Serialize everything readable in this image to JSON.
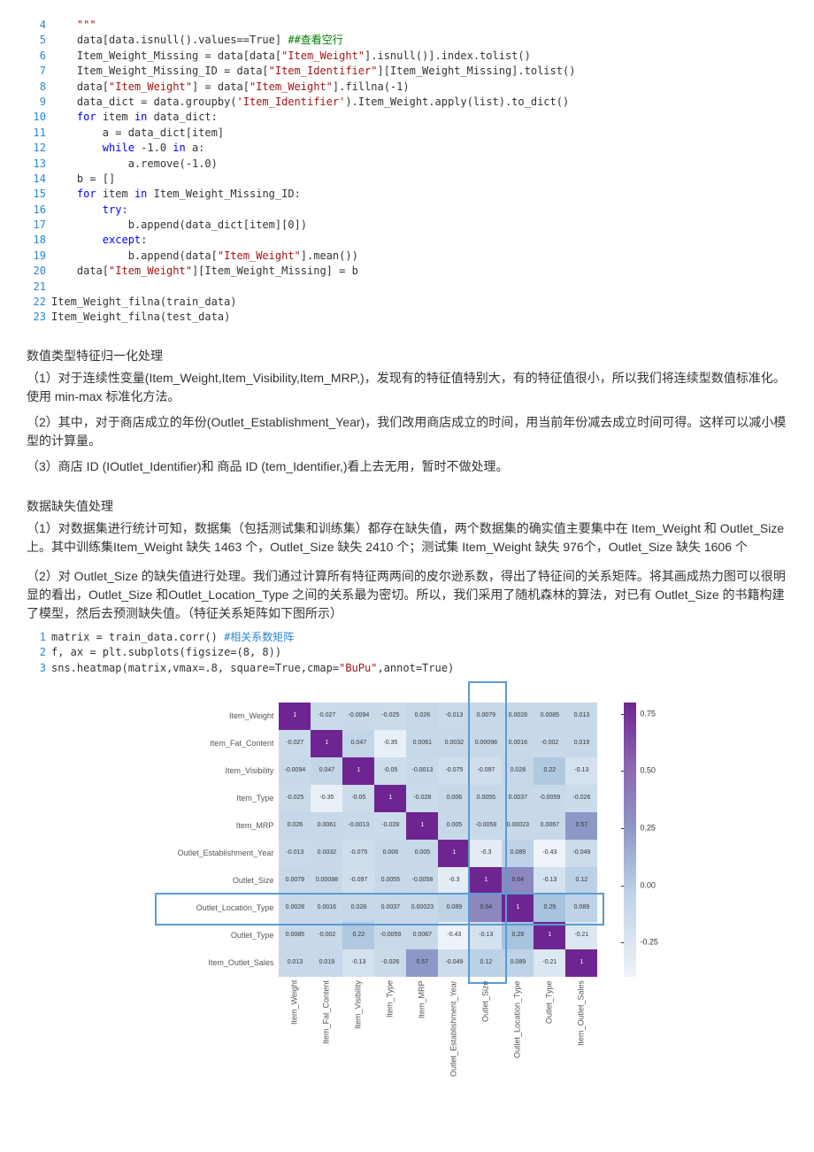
{
  "code1": [
    {
      "n": "4",
      "html": "    <span class='docstr'>\"\"\"</span>",
      "raw": "    \"\"\""
    },
    {
      "n": "5",
      "html": "    data[data.isnull().values==True] <span class='comment-green'>##查看空行</span>"
    },
    {
      "n": "6",
      "html": "    Item_Weight_Missing = data[data[<span class='str'>\"Item_Weight\"</span>].isnull()].index.tolist()"
    },
    {
      "n": "7",
      "html": "    Item_Weight_Missing_ID = data[<span class='str'>\"Item_Identifier\"</span>][Item_Weight_Missing].tolist()"
    },
    {
      "n": "8",
      "html": "    data[<span class='str'>\"Item_Weight\"</span>] = data[<span class='str'>\"Item_Weight\"</span>].fillna(-1)"
    },
    {
      "n": "9",
      "html": "    data_dict = data.groupby(<span class='str'>'Item_Identifier'</span>).Item_Weight.apply(list).to_dict()"
    },
    {
      "n": "10",
      "html": "    <span class='kw'>for</span> item <span class='kw'>in</span> data_dict:"
    },
    {
      "n": "11",
      "html": "        a = data_dict[item]"
    },
    {
      "n": "12",
      "html": "        <span class='kw'>while</span> -1.0 <span class='kw'>in</span> a:"
    },
    {
      "n": "13",
      "html": "            a.remove(-1.0)"
    },
    {
      "n": "14",
      "html": "    b = []"
    },
    {
      "n": "15",
      "html": "    <span class='kw'>for</span> item <span class='kw'>in</span> Item_Weight_Missing_ID:"
    },
    {
      "n": "16",
      "html": "        <span class='kw'>try</span>:"
    },
    {
      "n": "17",
      "html": "            b.append(data_dict[item][0])"
    },
    {
      "n": "18",
      "html": "        <span class='kw'>except</span>:"
    },
    {
      "n": "19",
      "html": "            b.append(data[<span class='str'>\"Item_Weight\"</span>].mean())"
    },
    {
      "n": "20",
      "html": "    data[<span class='str'>\"Item_Weight\"</span>][Item_Weight_Missing] = b"
    },
    {
      "n": "21",
      "html": ""
    },
    {
      "n": "22",
      "html": "Item_Weight_filna(train_data)"
    },
    {
      "n": "23",
      "html": "Item_Weight_filna(test_data)"
    }
  ],
  "section1_heading": "数值类型特征归一化处理",
  "section1_p1": "（1）对于连续性变量(Item_Weight,Item_Visibility,Item_MRP,)，发现有的特征值特别大，有的特征值很小，所以我们将连续型数值标准化。使用 min-max 标准化方法。",
  "section1_p2": "（2）其中，对于商店成立的年份(Outlet_Establishment_Year)，我们改用商店成立的时间，用当前年份减去成立时间可得。这样可以减小模型的计算量。",
  "section1_p3": "（3）商店 ID (IOutlet_Identifier)和 商品 ID (tem_Identifier,)看上去无用，暂时不做处理。",
  "section2_heading": "数据缺失值处理",
  "section2_p1": "（1）对数据集进行统计可知，数据集（包括测试集和训练集）都存在缺失值，两个数据集的确实值主要集中在 Item_Weight 和 Outlet_Size 上。其中训练集Item_Weight 缺失 1463 个，Outlet_Size 缺失 2410 个；测试集 Item_Weight 缺失 976个，Outlet_Size 缺失 1606 个",
  "section2_p2": "（2）对 Outlet_Size 的缺失值进行处理。我们通过计算所有特征两两间的皮尔逊系数，得出了特征间的关系矩阵。将其画成热力图可以很明显的看出，Outlet_Size 和Outlet_Location_Type 之间的关系最为密切。所以，我们采用了随机森林的算法，对已有 Outlet_Size 的书籍构建了模型，然后去预测缺失值。（特征关系矩阵如下图所示）",
  "code2": [
    {
      "n": "1",
      "html": "matrix = train_data.corr() <span class='comment-blue'>#相关系数矩阵</span>"
    },
    {
      "n": "2",
      "html": "f, ax = plt.subplots(figsize=(8, 8))"
    },
    {
      "n": "3",
      "html": "sns.heatmap(matrix,vmax=.8, square=True,cmap=<span class='str'>\"BuPu\"</span>,annot=True)"
    }
  ],
  "chart_data": {
    "type": "heatmap",
    "cmap": "BuPu",
    "vmax": 0.8,
    "labels": [
      "Item_Weight",
      "Item_Fat_Content",
      "Item_Visibility",
      "Item_Type",
      "Item_MRP",
      "Outlet_Establishment_Year",
      "Outlet_Size",
      "Outlet_Location_Type",
      "Outlet_Type",
      "Item_Outlet_Sales"
    ],
    "matrix": [
      [
        1,
        -0.027,
        -0.0094,
        -0.025,
        0.026,
        -0.013,
        0.0079,
        0.0028,
        0.0085,
        0.013
      ],
      [
        -0.027,
        1,
        0.047,
        -0.35,
        0.0061,
        0.0032,
        0.00098,
        0.0016,
        -0.002,
        0.019
      ],
      [
        -0.0094,
        0.047,
        1,
        -0.05,
        -0.0013,
        -0.075,
        -0.097,
        0.028,
        0.22,
        -0.13
      ],
      [
        -0.025,
        -0.35,
        -0.05,
        1,
        -0.028,
        0.006,
        0.0055,
        0.0037,
        -0.0059,
        -0.026
      ],
      [
        0.026,
        0.0061,
        -0.0013,
        -0.028,
        1,
        0.005,
        -0.0058,
        0.00023,
        0.0067,
        0.57
      ],
      [
        -0.013,
        0.0032,
        -0.075,
        0.006,
        0.005,
        1,
        -0.3,
        0.089,
        -0.43,
        -0.049
      ],
      [
        0.0079,
        0.00098,
        -0.097,
        0.0055,
        -0.0058,
        -0.3,
        1,
        0.64,
        -0.13,
        0.12
      ],
      [
        0.0028,
        0.0016,
        0.028,
        0.0037,
        0.00023,
        0.089,
        0.64,
        1,
        0.29,
        0.089
      ],
      [
        0.0085,
        -0.002,
        0.22,
        -0.0059,
        0.0067,
        -0.43,
        -0.13,
        0.29,
        1,
        -0.21
      ],
      [
        0.013,
        0.019,
        -0.13,
        -0.026,
        0.57,
        -0.049,
        0.12,
        0.089,
        -0.21,
        1
      ]
    ],
    "colorbar_ticks": [
      0.75,
      0.5,
      0.25,
      0.0,
      -0.25
    ]
  }
}
